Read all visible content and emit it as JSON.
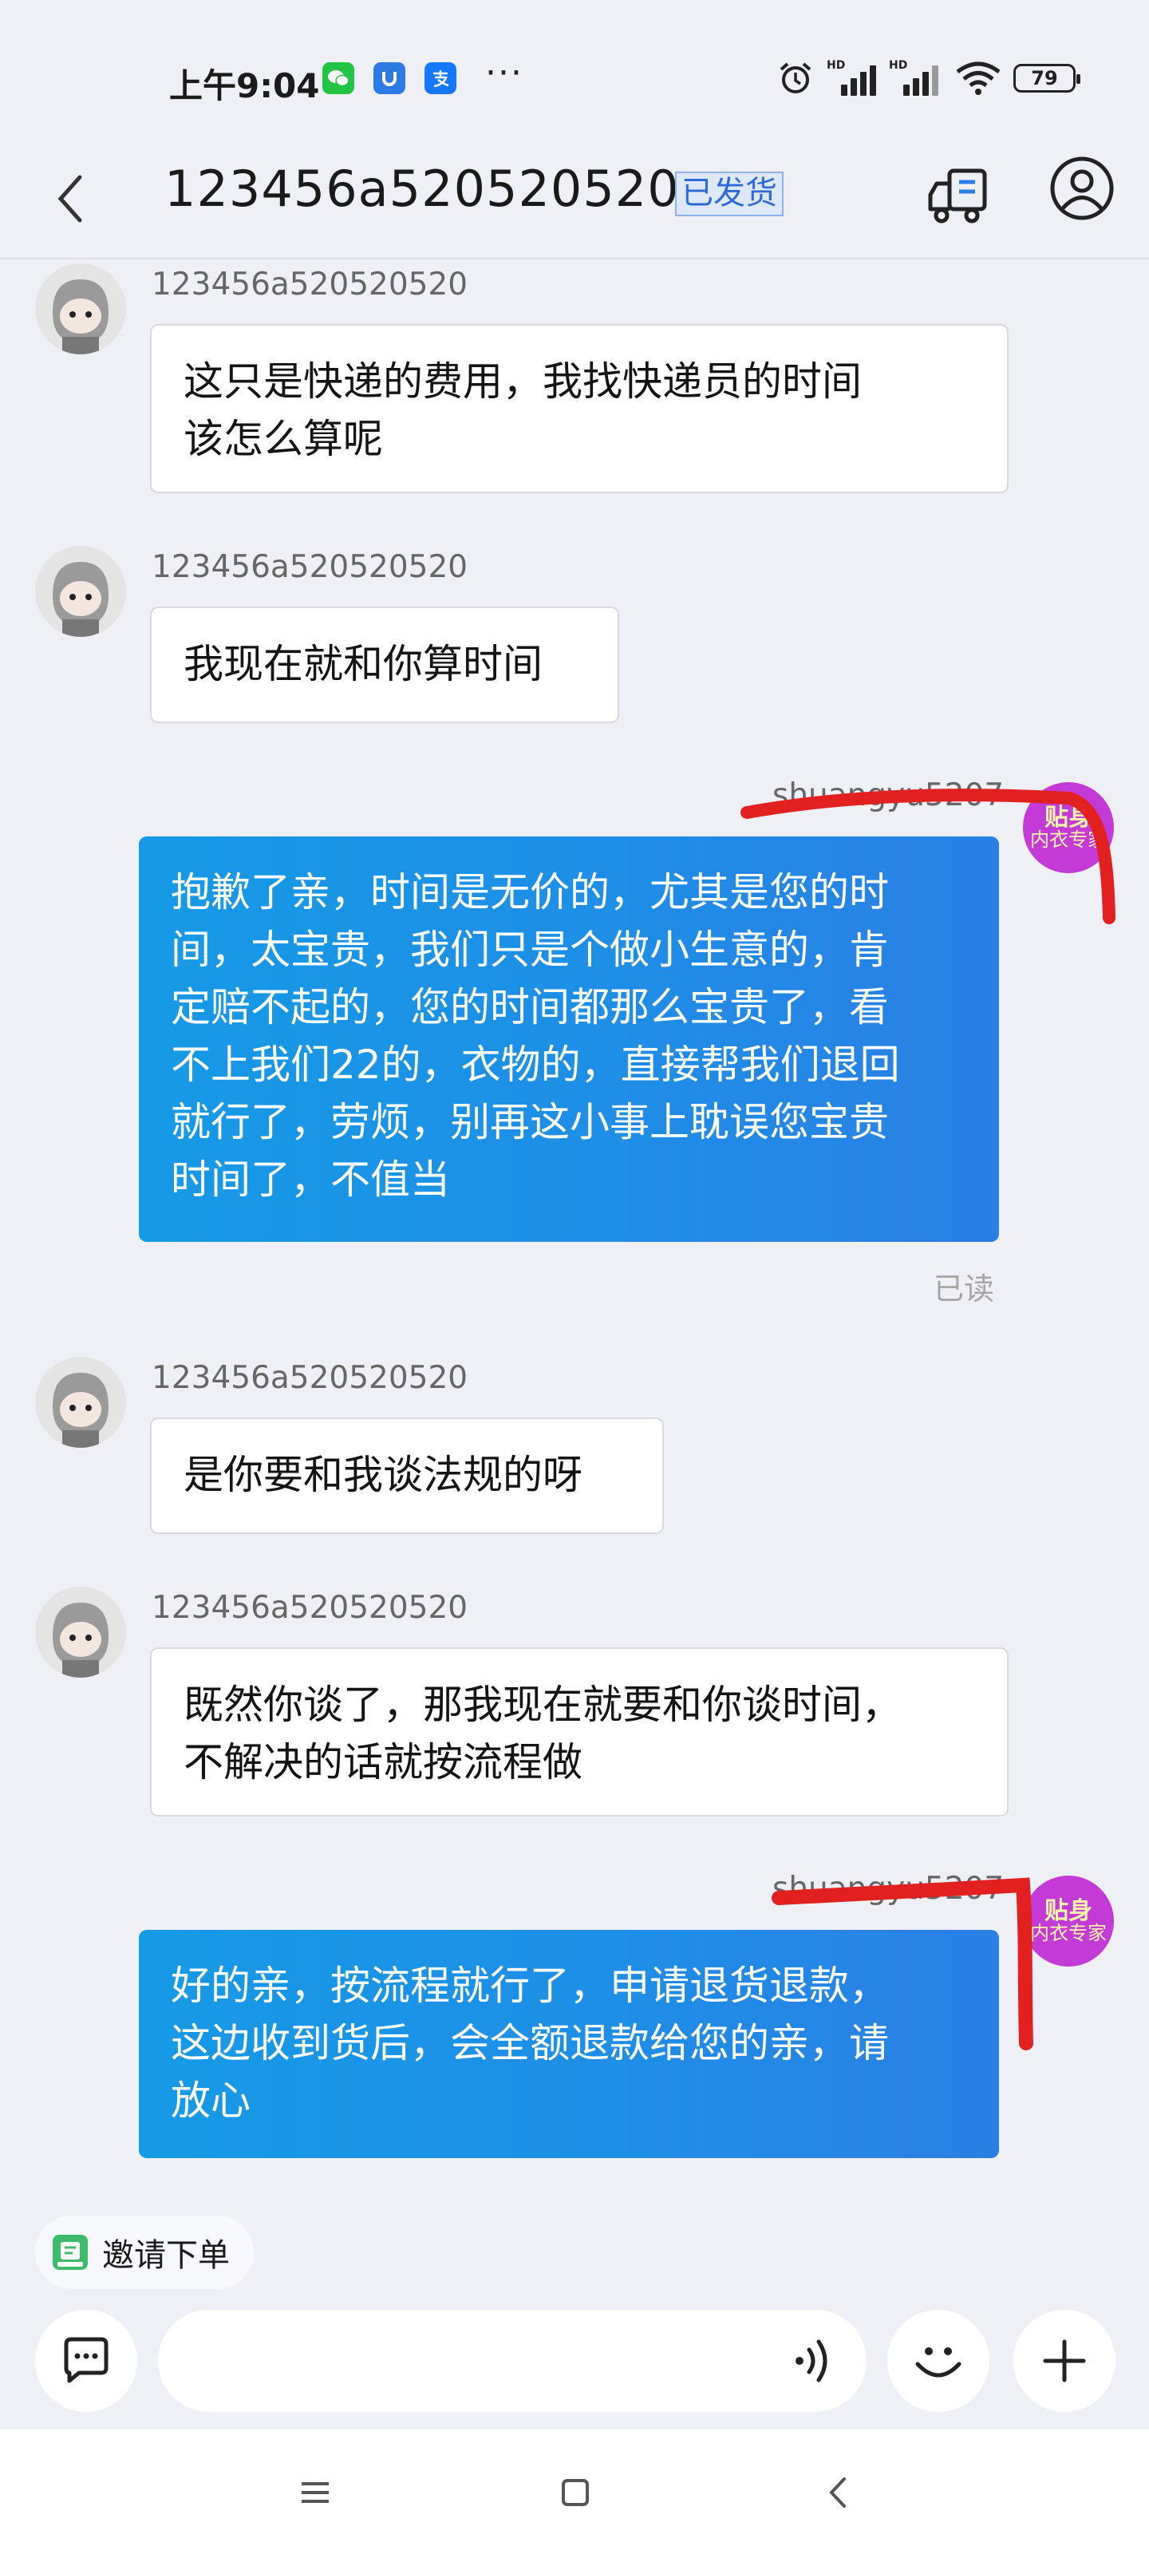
{
  "status_bar": {
    "time": "上午9:04",
    "icons": [
      "wechat-icon",
      "app-shield-icon",
      "alipay-icon"
    ],
    "more": "···",
    "battery": "79",
    "network_label": "HD"
  },
  "header": {
    "title": "123456a520520520",
    "badge": "已发货",
    "icons": [
      "back-icon",
      "truck-icon",
      "user-icon"
    ]
  },
  "messages": [
    {
      "side": "in",
      "sender": "123456a520520520",
      "text": [
        "这只是快递的费用，我找快递员的时间",
        "该怎么算呢"
      ]
    },
    {
      "side": "in",
      "sender": "123456a520520520",
      "text": [
        "我现在就和你算时间"
      ]
    },
    {
      "side": "out",
      "sender": "shuangyu5207",
      "avatar": {
        "line1": "贴身",
        "line2": "内衣专家"
      },
      "text": [
        "抱歉了亲，时间是无价的，尤其是您的时",
        "间，太宝贵，我们只是个做小生意的，肯",
        "定赔不起的，您的时间都那么宝贵了，看",
        "不上我们22的，衣物的，直接帮我们退回",
        "就行了，劳烦，别再这小事上耽误您宝贵",
        "时间了，不值当"
      ],
      "status": "已读"
    },
    {
      "side": "in",
      "sender": "123456a520520520",
      "text": [
        "是你要和我谈法规的呀"
      ]
    },
    {
      "side": "in",
      "sender": "123456a520520520",
      "text": [
        "既然你谈了，那我现在就要和你谈时间，",
        "不解决的话就按流程做"
      ]
    },
    {
      "side": "out",
      "sender": "shuangyu5207",
      "avatar": {
        "line1": "贴身",
        "line2": "内衣专家"
      },
      "text": [
        "好的亲，按流程就行了，申请退货退款，",
        "这边收到货后，会全额退款给您的亲，请",
        "放心"
      ]
    }
  ],
  "invite": {
    "label": "邀请下单"
  },
  "input": {
    "placeholder": ""
  },
  "colors": {
    "outgoing_bubble": "#1e8ee6",
    "incoming_bubble": "#ffffff",
    "badge": "#2f6bd8",
    "redaction": "#e32020",
    "shop_avatar": "#c43ad6"
  }
}
